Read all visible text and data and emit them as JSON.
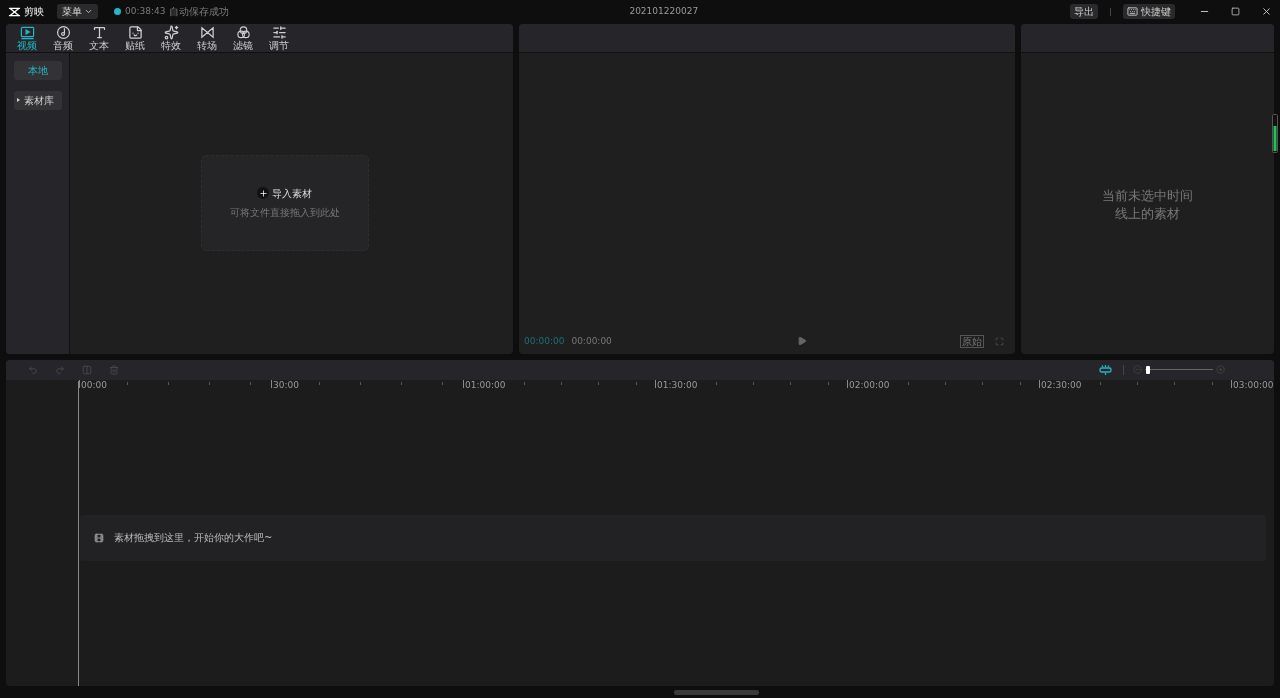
{
  "title_bar": {
    "app_name": "剪映",
    "menu": "菜单",
    "save_time": "00:38:43",
    "save_status": "自动保存成功",
    "project": "202101220027",
    "export": "导出",
    "shortcuts": "快捷键"
  },
  "media_tabs": [
    {
      "label": "视频",
      "kind": "video",
      "selected": true
    },
    {
      "label": "音频",
      "kind": "audio",
      "selected": false
    },
    {
      "label": "文本",
      "kind": "text",
      "selected": false
    },
    {
      "label": "贴纸",
      "kind": "sticker",
      "selected": false
    },
    {
      "label": "特效",
      "kind": "effect",
      "selected": false
    },
    {
      "label": "转场",
      "kind": "transition",
      "selected": false
    },
    {
      "label": "滤镜",
      "kind": "filter",
      "selected": false
    },
    {
      "label": "调节",
      "kind": "adjust",
      "selected": false
    }
  ],
  "sidebar": {
    "items": [
      {
        "label": "本地",
        "selected": true,
        "expandable": false
      },
      {
        "label": "素材库",
        "selected": false,
        "expandable": true
      }
    ]
  },
  "import": {
    "label": "导入素材",
    "hint": "可将文件直接拖入到此处"
  },
  "player": {
    "current_time": "00:00:00",
    "total_time": "00:00:00",
    "ratio": "原始"
  },
  "inspector": {
    "empty_message": "当前未选中时间线上的素材"
  },
  "timeline": {
    "zoom": {
      "level": 0.05
    },
    "ruler": [
      "00:00",
      "30:00",
      "01:00:00",
      "01:30:00",
      "02:00:00",
      "02:30:00",
      "03:00:00"
    ],
    "track_hint": "素材拖拽到这里，开始你的大作吧~"
  }
}
